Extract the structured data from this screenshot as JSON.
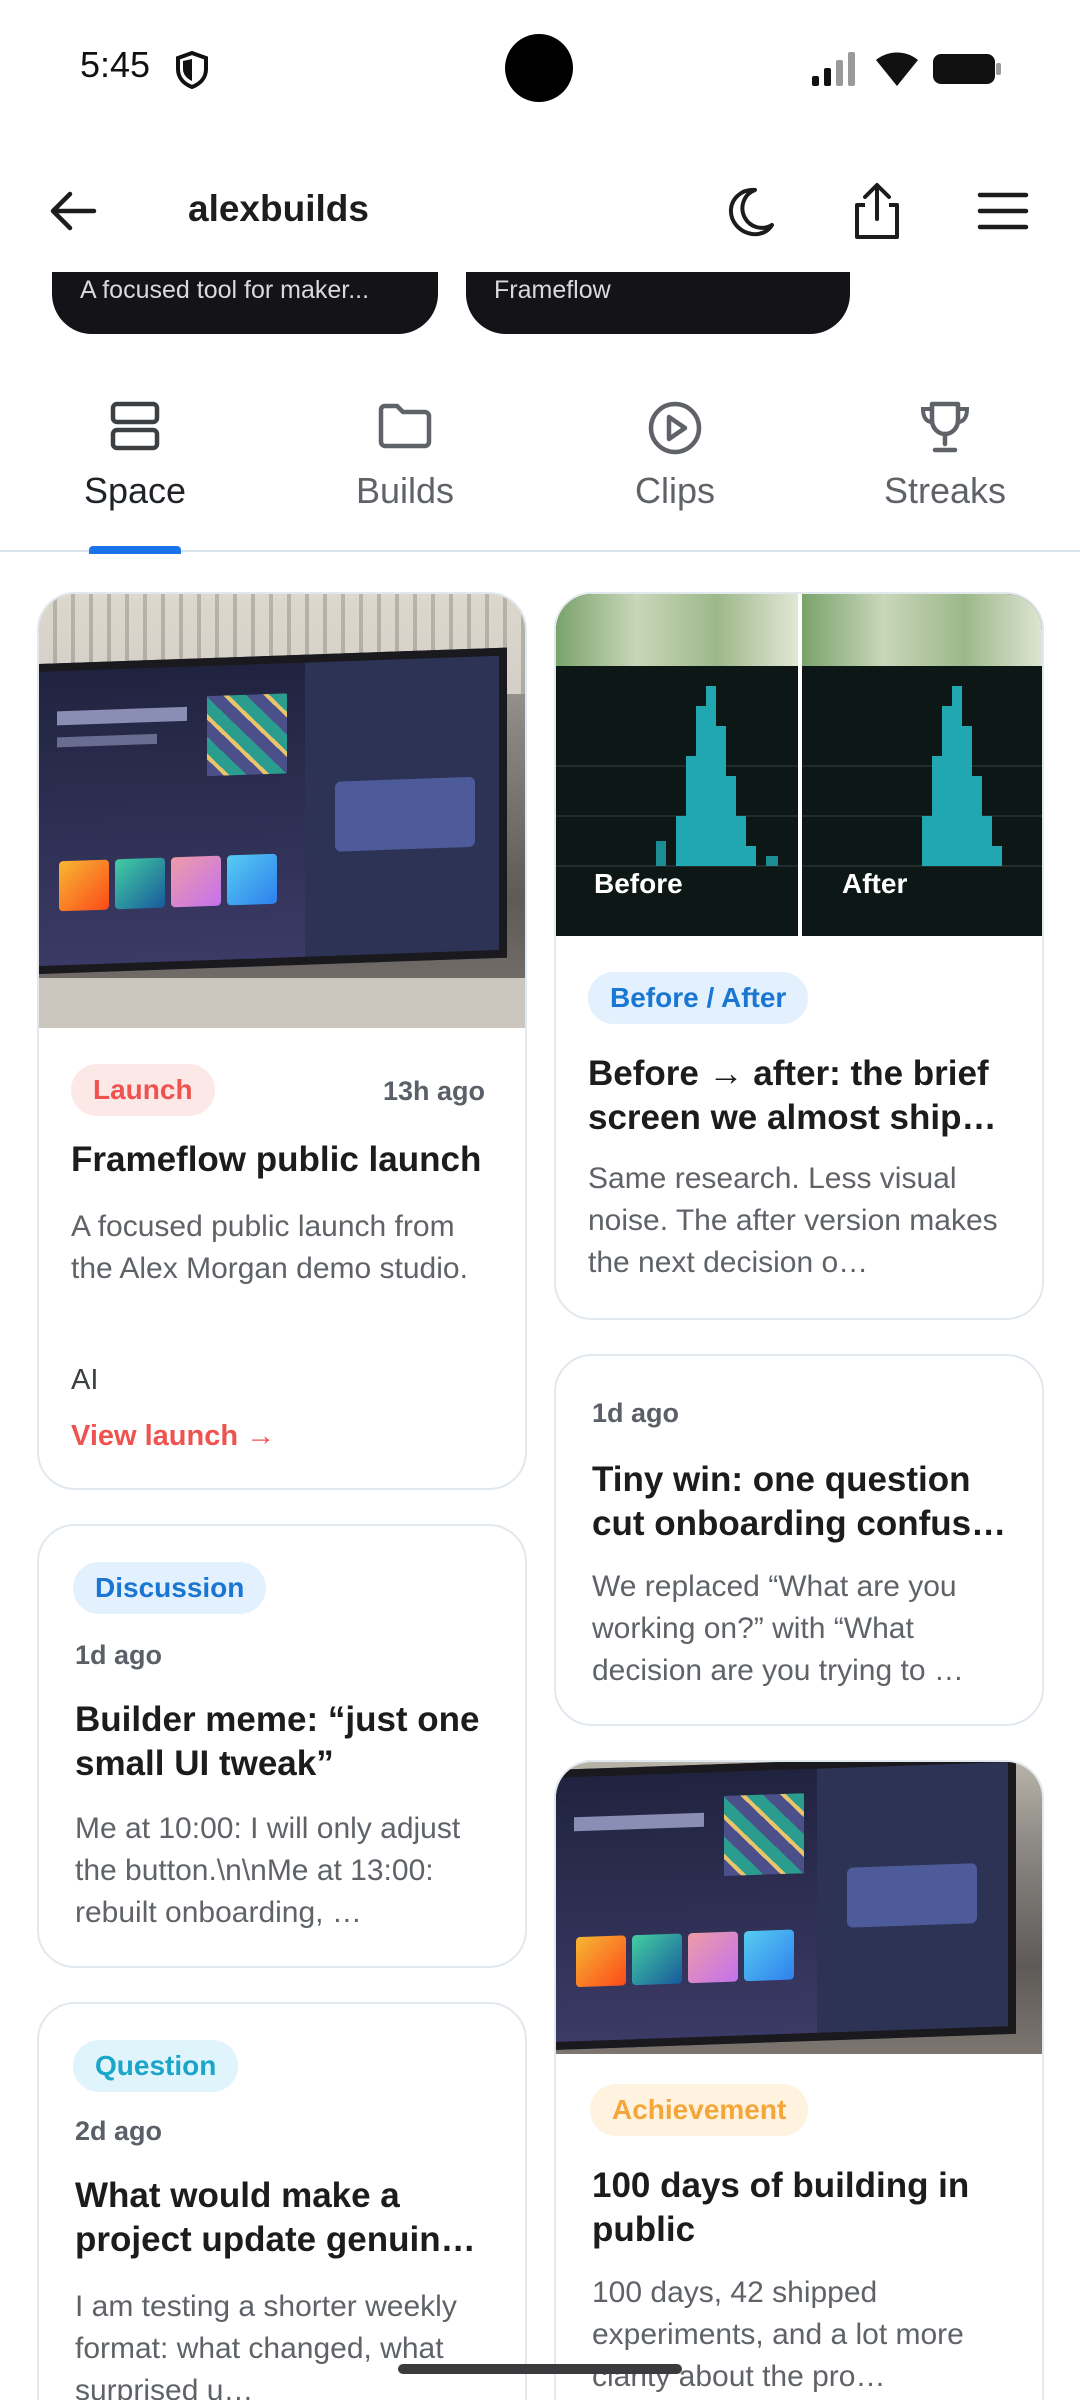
{
  "status": {
    "time": "5:45"
  },
  "header": {
    "title": "alexbuilds"
  },
  "projects": [
    {
      "caption": "A focused tool for maker..."
    },
    {
      "caption": "Frameflow"
    }
  ],
  "tabs": [
    {
      "label": "Space",
      "icon": "stack-icon"
    },
    {
      "label": "Builds",
      "icon": "folder-icon"
    },
    {
      "label": "Clips",
      "icon": "play-circle-icon"
    },
    {
      "label": "Streaks",
      "icon": "trophy-icon"
    }
  ],
  "feed": {
    "launch": {
      "tag": "Launch",
      "time": "13h ago",
      "title": "Frameflow public launch",
      "desc": "A focused public launch from the Alex Morgan demo studio.",
      "meta": "AI",
      "cta": "View launch →"
    },
    "discussion": {
      "tag": "Discussion",
      "time": "1d ago",
      "title": "Builder meme: “just one small UI tweak”",
      "desc": "Me at 10:00: I will only adjust the button.\\n\\nMe at 13:00: rebuilt onboarding, …"
    },
    "question": {
      "tag": "Question",
      "time": "2d ago",
      "title": "What would make a project update genuin…",
      "desc": "I am testing a shorter weekly format: what changed, what surprised u…"
    },
    "beforeafter": {
      "before_label": "Before",
      "after_label": "After",
      "tag": "Before / After",
      "title": "Before → after: the brief screen we almost ship…",
      "desc": "Same research. Less visual noise. The after version makes the next decision o…"
    },
    "tinywin": {
      "time": "1d ago",
      "title": "Tiny win: one question cut onboarding confus…",
      "desc": "We replaced “What are you working on?” with “What decision are you trying to …"
    },
    "achievement": {
      "tag": "Achievement",
      "title": "100 days of building in public",
      "desc": "100 days, 42 shipped experiments, and a lot more clarity about the pro…"
    }
  },
  "colors": {
    "accent": "#1a73e8",
    "launch": "#ef5350",
    "achievement": "#f4a63b"
  }
}
